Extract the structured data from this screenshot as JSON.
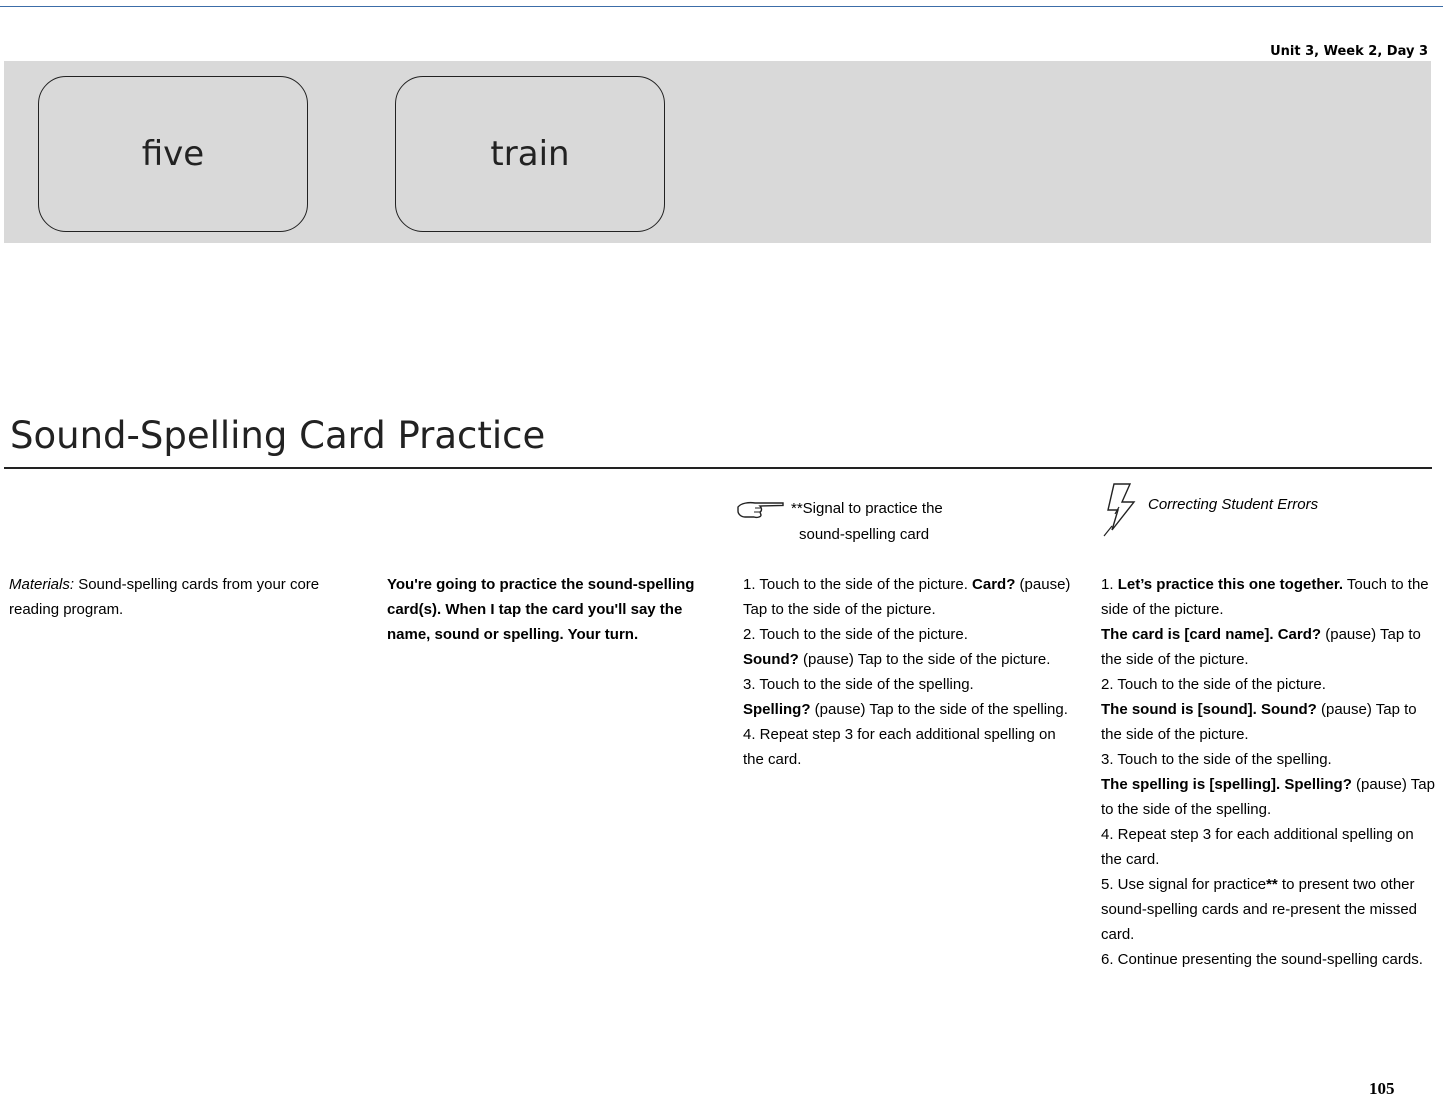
{
  "header": {
    "unit_label": "Unit 3, Week 2, Day 3"
  },
  "cards": [
    {
      "word": "five"
    },
    {
      "word": "train"
    }
  ],
  "title": "Sound-Spelling Card Practice",
  "materials": {
    "label": "Materials:",
    "text": " Sound-spelling cards from your core reading program."
  },
  "script": {
    "text": "You're going to practice the sound-spelling card(s). When I tap the card you'll say the name, sound or spelling. Your turn."
  },
  "signal": {
    "icon": "pointing-hand-icon",
    "heading_1": "**Signal to practice the",
    "heading_2": "sound-spelling card",
    "s1_a": "1. Touch to the side of the picture. ",
    "s1_b": "Card?",
    "s1_c": " (pause) Tap to the side of the picture.",
    "s2_a": "2. Touch to the side of the picture.",
    "s2_b": "Sound?",
    "s2_c": " (pause) Tap to the side of the picture.",
    "s3_a": "3. Touch to the side of the spelling.",
    "s3_b": "Spelling?",
    "s3_c": " (pause) Tap to the side of the spelling.",
    "s4": "4. Repeat step 3 for each additional spelling on the card."
  },
  "corrections": {
    "icon": "lightning-icon",
    "heading": "Correcting Student Errors",
    "c1_a": "1. ",
    "c1_b": "Let’s practice this one together.",
    "c1_c": " Touch to the side of the picture.",
    "c1_d": "The card is [card name]. Card?",
    "c1_e": " (pause) Tap to the side of the picture.",
    "c2_a": "2. Touch to the side of the picture.",
    "c2_b": "The sound is [sound]. Sound?",
    "c2_c": " (pause) Tap to the side of the picture.",
    "c3_a": "3. Touch to the side of the spelling.",
    "c3_b": "The spelling is [spelling]. Spelling?",
    "c3_c": " (pause) Tap to the side of the spelling.",
    "c4": "4. Repeat step 3 for each additional spelling on the card.",
    "c5_a": "5. Use signal for practice",
    "c5_b": "**",
    "c5_c": " to present two other sound-spelling cards and re-present the missed card.",
    "c6": "6. Continue presenting the sound-spelling cards."
  },
  "page_number": "105"
}
